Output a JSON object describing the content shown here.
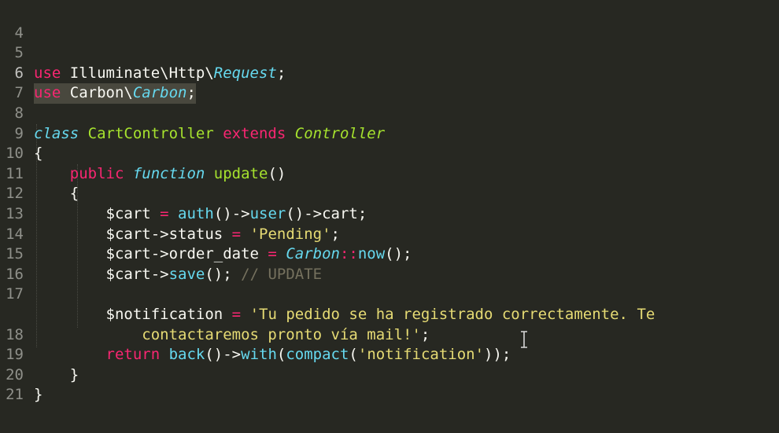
{
  "editor": {
    "theme_colors": {
      "background": "#272822",
      "keyword": "#f92672",
      "storage": "#66d9ef",
      "class_name": "#a6e22e",
      "string": "#e6db74",
      "comment": "#75715e",
      "line_number": "#8f908a",
      "selection": "#49483e"
    },
    "lines": [
      {
        "num": "4"
      },
      {
        "num": "5"
      },
      {
        "num": "6"
      },
      {
        "num": "7"
      },
      {
        "num": "8"
      },
      {
        "num": "9"
      },
      {
        "num": "10"
      },
      {
        "num": "11"
      },
      {
        "num": "12"
      },
      {
        "num": "13"
      },
      {
        "num": "14"
      },
      {
        "num": "15"
      },
      {
        "num": "16"
      },
      {
        "num": "17"
      },
      {
        "num": ""
      },
      {
        "num": "18"
      },
      {
        "num": "19"
      },
      {
        "num": "20"
      },
      {
        "num": "21"
      }
    ],
    "tokens": {
      "l5": {
        "kw": "use",
        "ns1": " Illuminate\\Http\\",
        "cls": "Request",
        "end": ";"
      },
      "l6": {
        "kw": "use",
        "ns1": " Carbon\\",
        "cls": "Carbon",
        "end": ";"
      },
      "l8": {
        "kw1": "class",
        "name": " CartController ",
        "kw2": "extends",
        "parent": " Controller"
      },
      "l9": {
        "brace": "{"
      },
      "l10": {
        "indent": "    ",
        "kw": "public",
        "storage": " function",
        "fn": " update",
        "paren": "()"
      },
      "l11": {
        "indent": "    ",
        "brace": "{"
      },
      "l12": {
        "indent": "        ",
        "v": "$cart",
        "op": " = ",
        "f1": "auth",
        "p1": "()->",
        "f2": "user",
        "p2": "()->cart;"
      },
      "l13": {
        "indent": "        ",
        "v": "$cart->status",
        "op": " = ",
        "s": "'Pending'",
        "end": ";"
      },
      "l14": {
        "indent": "        ",
        "v": "$cart->order_date",
        "op": " = ",
        "c": "Carbon",
        "p1": "::",
        "f": "now",
        "end": "();"
      },
      "l15": {
        "indent": "        ",
        "v": "$cart->",
        "f": "save",
        "end": "(); ",
        "cm": "// UPDATE"
      },
      "l17": {
        "indent": "        ",
        "v": "$notification",
        "op": " = ",
        "s": "'Tu pedido se ha registrado correctamente. Te"
      },
      "l17b": {
        "indent": "            ",
        "s": "contactaremos pronto vía mail!'",
        "end": ";"
      },
      "l18": {
        "indent": "        ",
        "kw": "return",
        "f1": " back",
        "p1": "()->",
        "f2": "with",
        "p2": "(",
        "f3": "compact",
        "p3": "(",
        "s": "'notification'",
        "end": "));"
      },
      "l19": {
        "indent": "    ",
        "brace": "}"
      },
      "l20": {
        "brace": "}"
      }
    }
  }
}
